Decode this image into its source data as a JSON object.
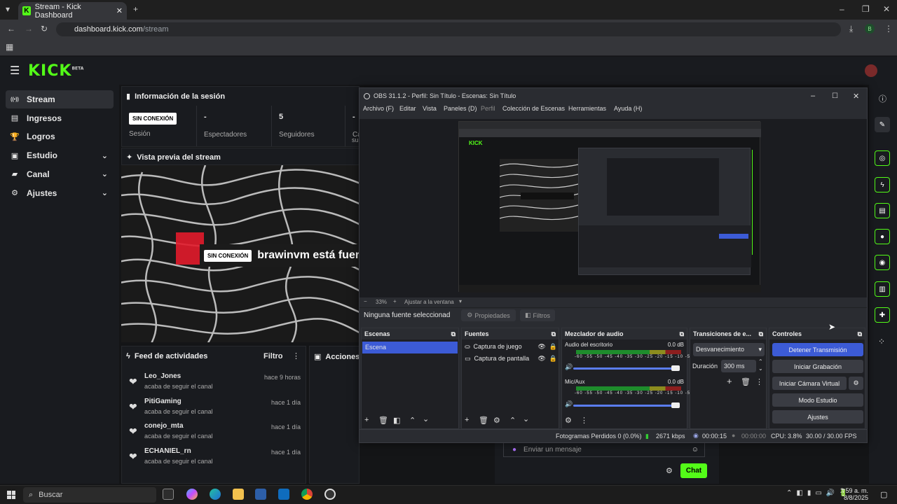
{
  "browser": {
    "tab_title": "Stream - Kick Dashboard",
    "url_host": "dashboard.kick.com",
    "url_path": "/stream",
    "profile_initial": "B"
  },
  "kick": {
    "logo": "KICK",
    "logo_badge": "BETA",
    "nav": [
      {
        "label": "Stream",
        "icon": "stream-icon",
        "active": true
      },
      {
        "label": "Ingresos",
        "icon": "revenue-icon"
      },
      {
        "label": "Logros",
        "icon": "trophy-icon"
      },
      {
        "label": "Estudio",
        "icon": "studio-icon",
        "expand": true
      },
      {
        "label": "Canal",
        "icon": "channel-icon",
        "expand": true
      },
      {
        "label": "Ajustes",
        "icon": "gear-icon",
        "expand": true
      }
    ],
    "session": {
      "title": "Información de la sesión",
      "badge": "SIN CONEXIÓN",
      "stats": [
        {
          "value": "",
          "label": "Sesión"
        },
        {
          "value": "-",
          "label": "Espectadores"
        },
        {
          "value": "5",
          "label": "Seguidores"
        },
        {
          "value": "-",
          "label": "Ca"
        }
      ],
      "extra": "su"
    },
    "preview": {
      "title": "Vista previa del stream",
      "badge": "SIN CONEXIÓN",
      "message": "brawinvm está fuera"
    },
    "feed": {
      "title": "Feed de actividades",
      "filter": "Filtro",
      "items": [
        {
          "name": "Leo_Jones",
          "action": "acaba de seguir el canal",
          "time": "hace 9 horas"
        },
        {
          "name": "PitiGaming",
          "action": "acaba de seguir el canal",
          "time": "hace 1 día"
        },
        {
          "name": "conejo_mta",
          "action": "acaba de seguir el canal",
          "time": "hace 1 día"
        },
        {
          "name": "ECHANIEL_rn",
          "action": "acaba de seguir el canal",
          "time": "hace 1 día"
        }
      ]
    },
    "actions": {
      "title": "Acciones de"
    },
    "chat": {
      "placeholder": "Enviar un mensaje",
      "button": "Chat"
    }
  },
  "obs": {
    "title": "OBS 31.1.2 - Perfil: Sin Título - Escenas: Sin Título",
    "menu": [
      "Archivo (F)",
      "Editar",
      "Vista",
      "Paneles (D)",
      "Perfil",
      "Colección de Escenas",
      "Herramientas",
      "Ayuda (H)"
    ],
    "zoom": "33%",
    "fit": "Ajustar a la ventana",
    "no_source": "Ninguna fuente seleccionad",
    "properties": "Propiedades",
    "filters": "Filtros",
    "scenes": {
      "title": "Escenas",
      "items": [
        "Escena"
      ]
    },
    "sources": {
      "title": "Fuentes",
      "items": [
        "Captura de juego",
        "Captura de pantalla"
      ]
    },
    "mixer": {
      "title": "Mezclador de audio",
      "channels": [
        {
          "name": "Audio del escritorio",
          "db": "0.0 dB"
        },
        {
          "name": "Mic/Aux",
          "db": "0.0 dB"
        }
      ],
      "scale": "-60 -55 -50 -45 -40 -35 -30 -25 -20 -15 -10 -5 0"
    },
    "transitions": {
      "title": "Transiciones de e...",
      "type": "Desvanecimiento",
      "duration_label": "Duración",
      "duration": "300 ms"
    },
    "controls": {
      "title": "Controles",
      "buttons": [
        "Detener Transmisión",
        "Iniciar Grabación",
        "Iniciar Cámara Virtual",
        "Modo Estudio",
        "Ajustes"
      ]
    },
    "status": {
      "dropped": "Fotogramas Perdidos 0 (0.0%)",
      "kbps": "2671 kbps",
      "stream_time": "00:00:15",
      "rec_time": "00:00:00",
      "cpu": "CPU: 3.8%",
      "fps": "30.00 / 30.00 FPS"
    }
  },
  "taskbar": {
    "search": "Buscar",
    "time": "2:59 a. m.",
    "date": "8/8/2025"
  },
  "colors": {
    "kick_green": "#53fc18",
    "obs_blue": "#3c5bd6"
  }
}
